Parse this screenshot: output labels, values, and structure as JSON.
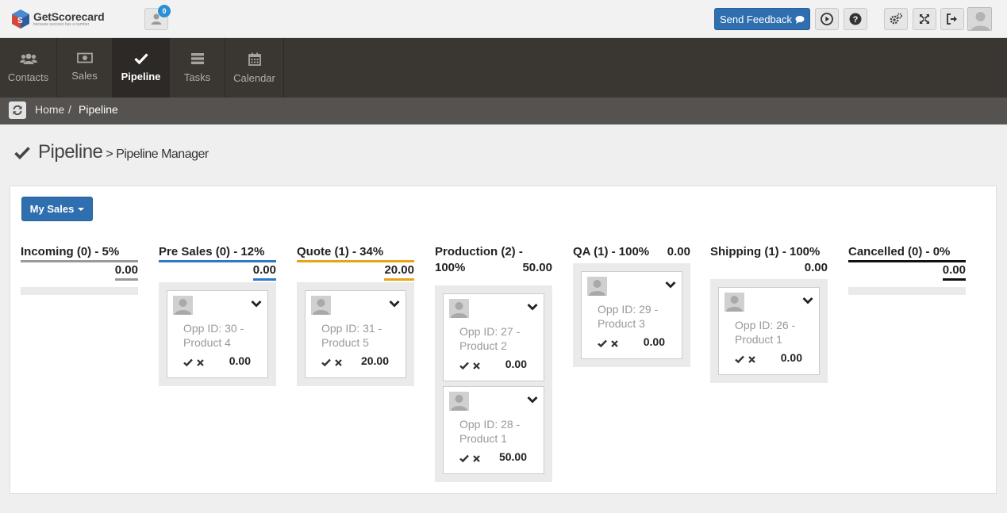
{
  "app": {
    "name": "GetScorecard",
    "tagline": "because success has a number",
    "notification_count": "0",
    "feedback_label": "Send Feedback"
  },
  "nav": [
    {
      "label": "Contacts",
      "icon": "users-icon"
    },
    {
      "label": "Sales",
      "icon": "money-icon"
    },
    {
      "label": "Pipeline",
      "icon": "check-icon",
      "active": true
    },
    {
      "label": "Tasks",
      "icon": "tasks-icon"
    },
    {
      "label": "Calendar",
      "icon": "calendar-icon"
    }
  ],
  "breadcrumb": {
    "home": "Home",
    "sep": "/",
    "current": "Pipeline"
  },
  "page": {
    "title": "Pipeline",
    "subtitle": "> Pipeline Manager"
  },
  "filter": {
    "label": "My Sales"
  },
  "columns": [
    {
      "name": "Incoming (0) - 5%",
      "total": "0.00",
      "color": "#999999",
      "cards": []
    },
    {
      "name": "Pre Sales (0) - 12%",
      "total": "0.00",
      "color": "#2f78c4",
      "cards": [
        {
          "title": "Opp ID: 30 - Product 4",
          "value": "0.00"
        }
      ]
    },
    {
      "name": "Quote (1) - 34%",
      "total": "20.00",
      "color": "#e8a317",
      "cards": [
        {
          "title": "Opp ID: 31 - Product 5",
          "value": "20.00"
        }
      ]
    },
    {
      "name": "Production (2) - 100%",
      "name_line1": "Production (2) -",
      "name_line2": "100%",
      "total": "50.00",
      "color": "",
      "cards": [
        {
          "title": "Opp ID: 27 - Product 2",
          "value": "0.00"
        },
        {
          "title": "Opp ID: 28 - Product 1",
          "value": "50.00"
        }
      ]
    },
    {
      "name": "QA (1) - 100%",
      "total": "0.00",
      "color": "",
      "cards": [
        {
          "title": "Opp ID: 29 - Product 3",
          "value": "0.00"
        }
      ]
    },
    {
      "name": "Shipping (1) - 100%",
      "total": "0.00",
      "color": "",
      "cards": [
        {
          "title": "Opp ID: 26 - Product 1",
          "value": "0.00"
        }
      ]
    },
    {
      "name": "Cancelled (0) - 0%",
      "total": "0.00",
      "color": "#111111",
      "cards": []
    }
  ]
}
